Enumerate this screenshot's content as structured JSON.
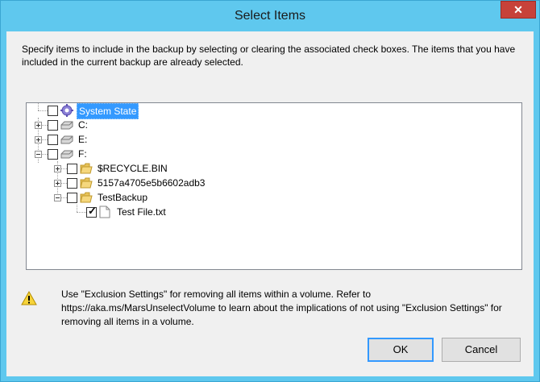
{
  "window": {
    "title": "Select Items",
    "close_label": "✕"
  },
  "description": "Specify items to include in the backup by selecting or clearing the associated check boxes. The items that you have included in the current backup are already selected.",
  "tree": {
    "items": [
      {
        "label": "System State",
        "checked": false,
        "selected": true
      },
      {
        "label": "C:",
        "checked": false
      },
      {
        "label": "E:",
        "checked": false
      },
      {
        "label": "F:",
        "checked": false
      },
      {
        "label": "$RECYCLE.BIN",
        "checked": false
      },
      {
        "label": "5157a4705e5b6602adb3",
        "checked": false
      },
      {
        "label": "TestBackup",
        "checked": false
      },
      {
        "label": "Test File.txt",
        "checked": true
      }
    ]
  },
  "warning": {
    "text": "Use \"Exclusion Settings\" for removing all items within a volume. Refer to https://aka.ms/MarsUnselectVolume to learn about the implications of not using \"Exclusion Settings\" for removing all items in a volume."
  },
  "buttons": {
    "ok_label": "OK",
    "cancel_label": "Cancel"
  },
  "colors": {
    "titlebar": "#5fc8ee",
    "close": "#c7423a",
    "selection": "#3399ff"
  }
}
